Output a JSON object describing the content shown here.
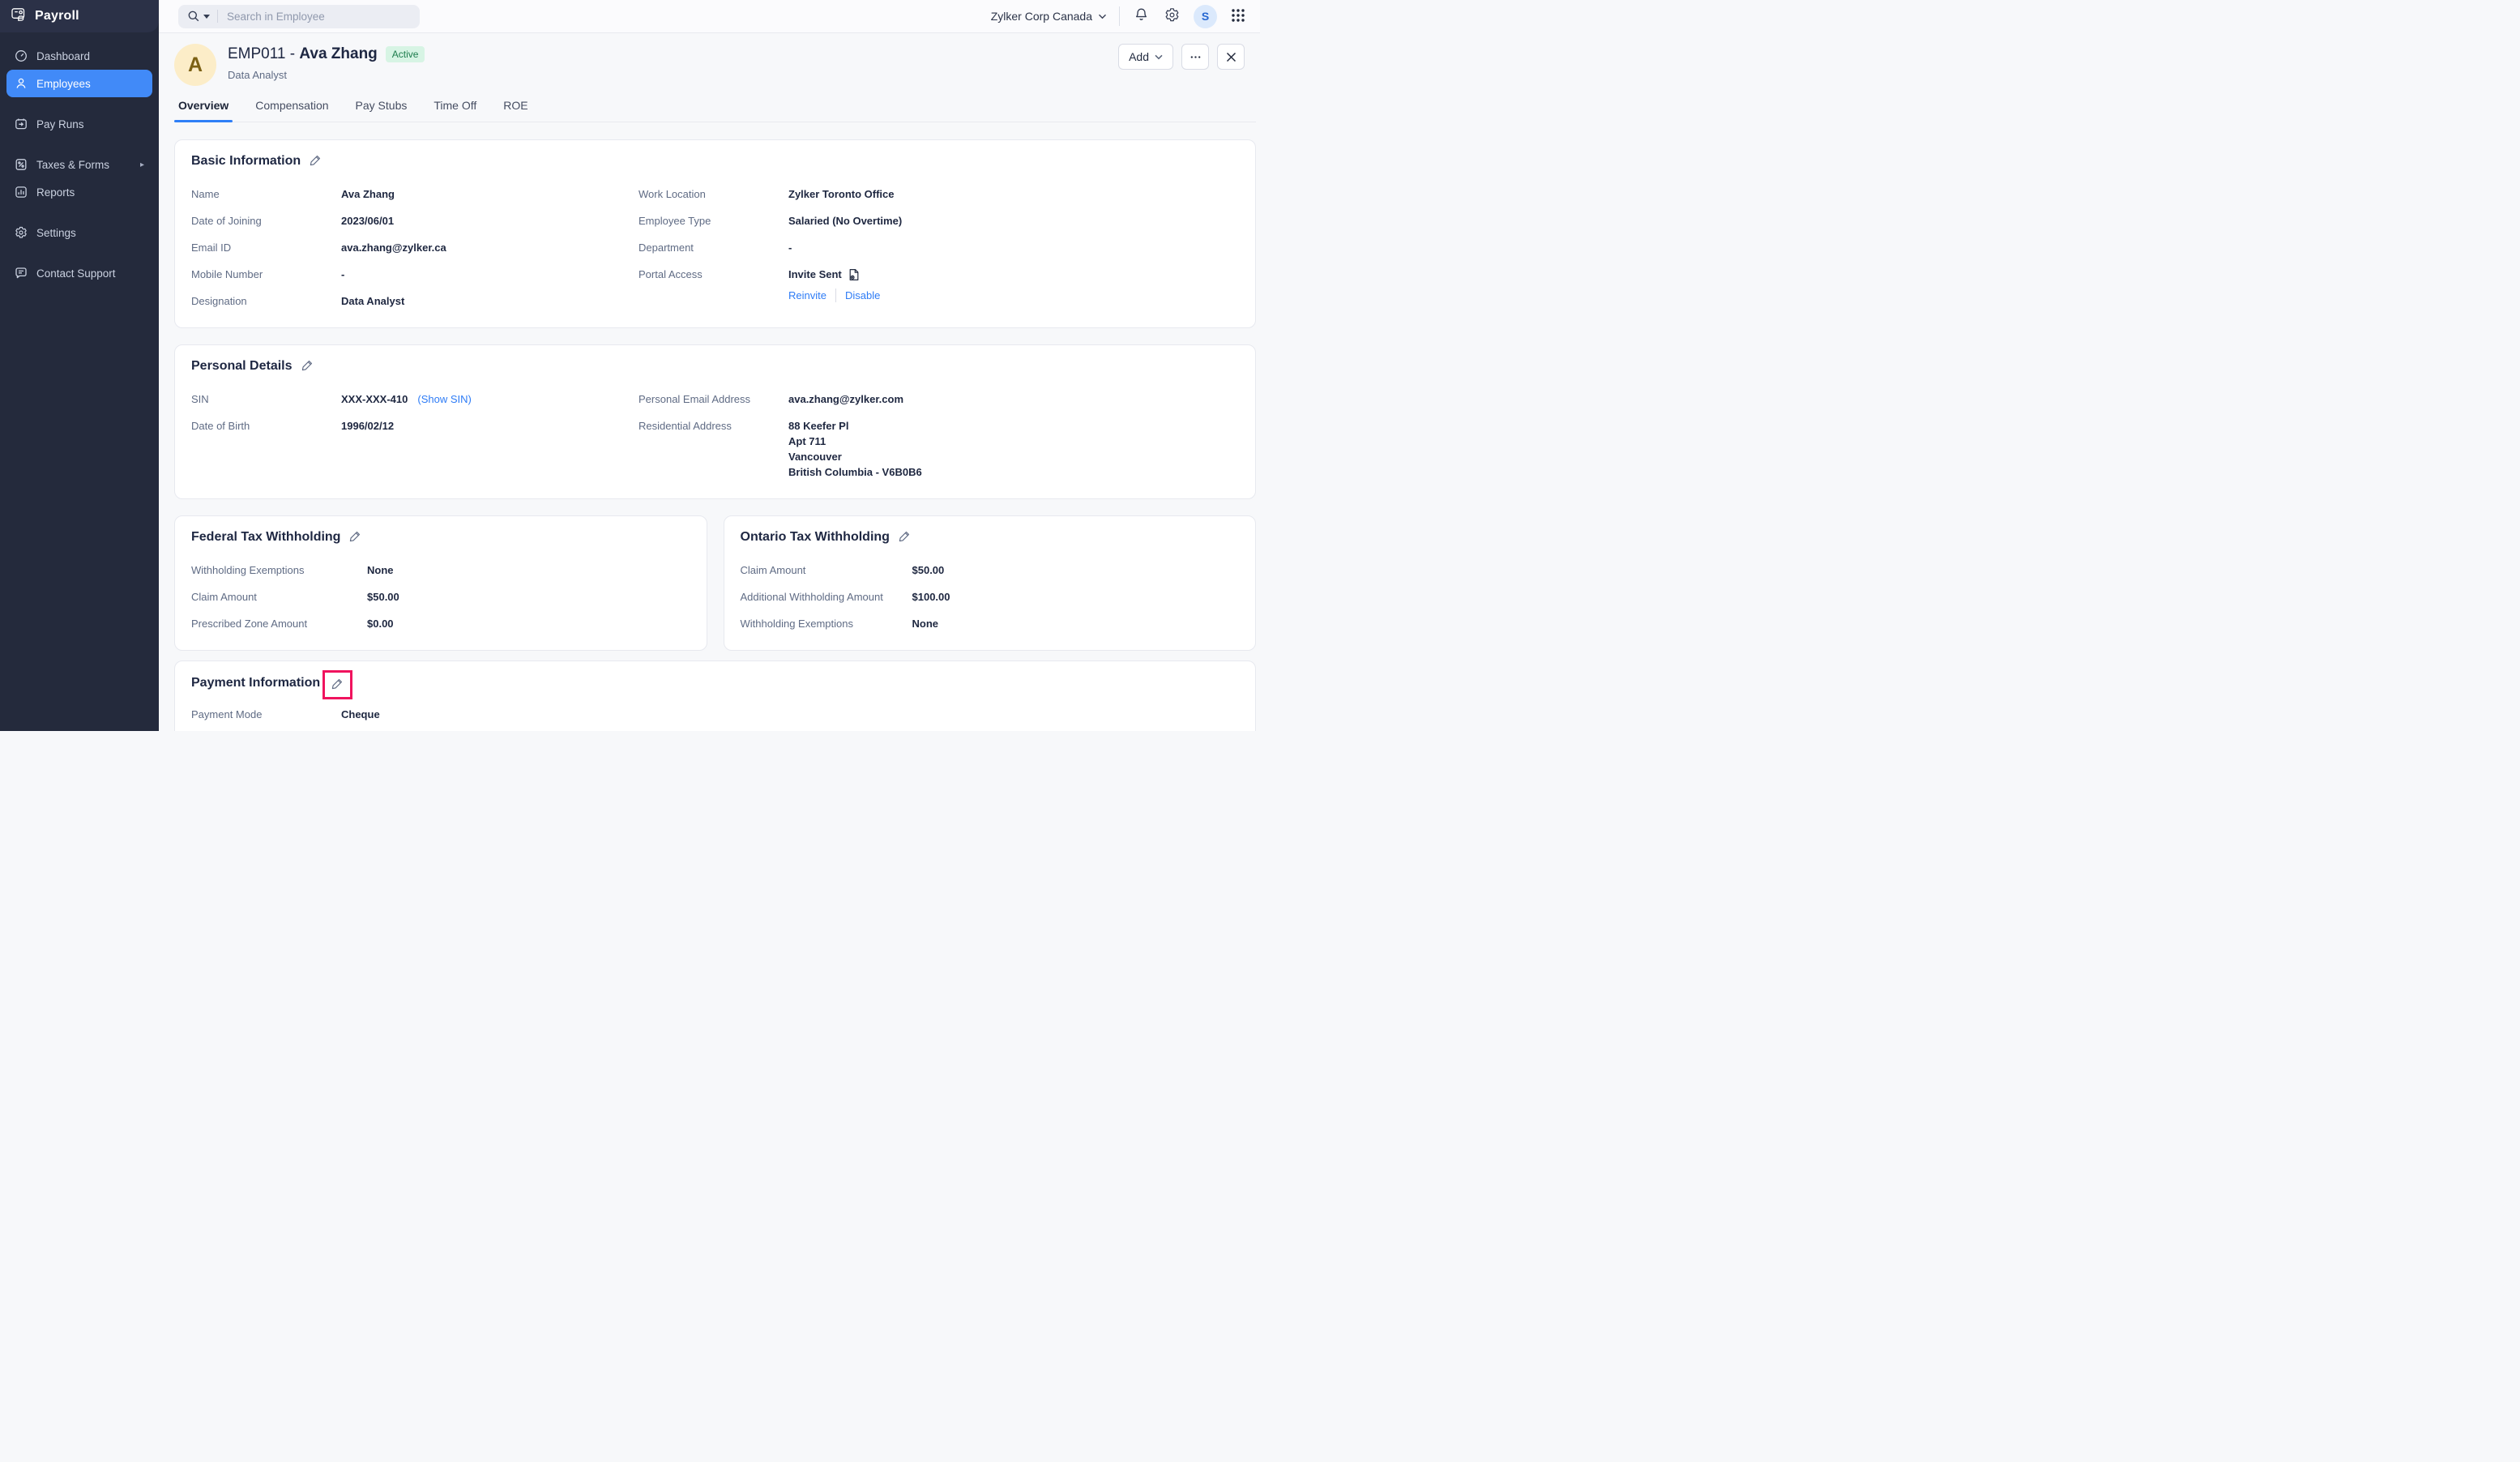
{
  "topbar": {
    "search_placeholder": "Search in Employee",
    "org_name": "Zylker Corp Canada",
    "user_initial": "S"
  },
  "sidebar": {
    "app_name": "Payroll",
    "items": [
      {
        "label": "Dashboard",
        "icon": "dashboard-icon",
        "active": false,
        "gap_before": false,
        "chevron": false
      },
      {
        "label": "Employees",
        "icon": "employees-icon",
        "active": true,
        "gap_before": false,
        "chevron": false
      },
      {
        "label": "Pay Runs",
        "icon": "payruns-icon",
        "active": false,
        "gap_before": true,
        "chevron": false
      },
      {
        "label": "Taxes & Forms",
        "icon": "taxes-icon",
        "active": false,
        "gap_before": true,
        "chevron": true
      },
      {
        "label": "Reports",
        "icon": "reports-icon",
        "active": false,
        "gap_before": false,
        "chevron": false
      },
      {
        "label": "Settings",
        "icon": "settings-icon",
        "active": false,
        "gap_before": true,
        "chevron": false
      },
      {
        "label": "Contact Support",
        "icon": "support-icon",
        "active": false,
        "gap_before": true,
        "chevron": false
      }
    ]
  },
  "header": {
    "avatar_initial": "A",
    "employee_code": "EMP011 - ",
    "employee_name": "Ava Zhang",
    "status": "Active",
    "designation": "Data Analyst",
    "add_label": "Add"
  },
  "tabs": [
    {
      "label": "Overview",
      "active": true
    },
    {
      "label": "Compensation",
      "active": false
    },
    {
      "label": "Pay Stubs",
      "active": false
    },
    {
      "label": "Time Off",
      "active": false
    },
    {
      "label": "ROE",
      "active": false
    }
  ],
  "cards": {
    "basic": {
      "title": "Basic Information",
      "left": [
        {
          "label": "Name",
          "value": "Ava Zhang"
        },
        {
          "label": "Date of Joining",
          "value": "2023/06/01"
        },
        {
          "label": "Email ID",
          "value": "ava.zhang@zylker.ca"
        },
        {
          "label": "Mobile Number",
          "value": "-"
        },
        {
          "label": "Designation",
          "value": "Data Analyst"
        }
      ],
      "right": [
        {
          "label": "Work Location",
          "value": "Zylker Toronto Office"
        },
        {
          "label": "Employee Type",
          "value": "Salaried (No Overtime)"
        },
        {
          "label": "Department",
          "value": "-"
        },
        {
          "label": "Portal Access",
          "value": "Invite Sent",
          "icon": "doc-eye-icon",
          "links": [
            "Reinvite",
            "Disable"
          ]
        }
      ]
    },
    "personal": {
      "title": "Personal Details",
      "left": [
        {
          "label": "SIN",
          "value": "XXX-XXX-410",
          "link": "(Show SIN)"
        },
        {
          "label": "Date of Birth",
          "value": "1996/02/12"
        }
      ],
      "right": [
        {
          "label": "Personal Email Address",
          "value": "ava.zhang@zylker.com"
        },
        {
          "label": "Residential Address",
          "lines": [
            "88 Keefer Pl",
            "Apt 711",
            "Vancouver",
            "British Columbia - V6B0B6"
          ]
        }
      ]
    },
    "federal": {
      "title": "Federal Tax Withholding",
      "fields": [
        {
          "label": "Withholding Exemptions",
          "value": "None"
        },
        {
          "label": "Claim Amount",
          "value": "$50.00"
        },
        {
          "label": "Prescribed Zone Amount",
          "value": "$0.00"
        }
      ]
    },
    "ontario": {
      "title": "Ontario Tax Withholding",
      "fields": [
        {
          "label": "Claim Amount",
          "value": "$50.00"
        },
        {
          "label": "Additional Withholding Amount",
          "value": "$100.00"
        },
        {
          "label": "Withholding Exemptions",
          "value": "None"
        }
      ]
    },
    "payment": {
      "title": "Payment Information",
      "highlighted": true,
      "fields": [
        {
          "label": "Payment Mode",
          "value": "Cheque"
        }
      ]
    }
  },
  "colors": {
    "sidebar_bg": "#242a3c",
    "active_item_blue": "#418af8",
    "link_blue": "#2e7cf6",
    "highlight_red": "#f0135e",
    "badge_green_bg": "#d7f4e4",
    "badge_green_text": "#1d7c4d",
    "avatar_bg": "#fcedc8",
    "avatar_text": "#7c6114"
  }
}
